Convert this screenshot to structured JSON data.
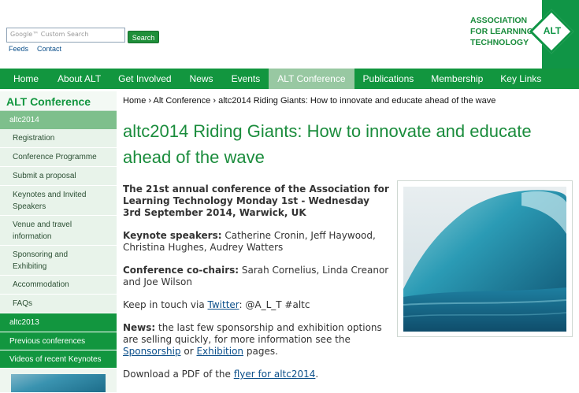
{
  "header": {
    "search_placeholder": "Google™ Custom Search",
    "search_button": "Search",
    "links": [
      "Feeds",
      "Contact"
    ],
    "logo_lines": [
      "ASSOCIATION",
      "FOR LEARNING",
      "TECHNOLOGY"
    ],
    "logo_badge": "ALT"
  },
  "nav": [
    "Home",
    "About ALT",
    "Get Involved",
    "News",
    "Events",
    "ALT Conference",
    "Publications",
    "Membership",
    "Key Links"
  ],
  "nav_active": "ALT Conference",
  "sidebar": {
    "title": "ALT Conference",
    "section": "altc2014",
    "items": [
      "Registration",
      "Conference Programme",
      "Submit a proposal",
      "Keynotes and Invited Speakers",
      "Venue and travel information",
      "Sponsoring and Exhibiting",
      "Accommodation",
      "FAQs"
    ],
    "lower": [
      "altc2013",
      "Previous conferences",
      "Videos of recent Keynotes"
    ]
  },
  "breadcrumb": [
    "Home",
    "Alt Conference",
    "altc2014 Riding Giants: How to innovate and educate ahead of the wave"
  ],
  "breadcrumb_sep": "›",
  "page": {
    "title": "altc2014 Riding Giants: How to innovate and educate ahead of the wave",
    "intro": "The 21st annual conference of the Association for Learning Technology Monday 1st - Wednesday 3rd September 2014, Warwick, UK",
    "keynote_label": "Keynote speakers:",
    "keynote_text": "Catherine Cronin, Jeff Haywood, Christina Hughes, Audrey Watters",
    "cochairs_label": "Conference co-chairs:",
    "cochairs_text": "Sarah Cornelius, Linda Creanor and Joe Wilson",
    "touch_pre": "Keep in touch via",
    "touch_link": "Twitter",
    "touch_post": ": @A_L_T #altc",
    "news_label": "News:",
    "news_text": "the last few sponsorship and exhibition options are selling quickly, for more information see the",
    "news_link1": "Sponsorship",
    "news_or": "or",
    "news_link2": "Exhibition",
    "news_end": "pages.",
    "download_pre": "Download a PDF of the",
    "download_link": "flyer for altc2014",
    "download_end": "."
  },
  "colors": {
    "brand_green": "#12963f",
    "active_tab": "#98c8a2",
    "link_blue": "#0b4f8a"
  }
}
